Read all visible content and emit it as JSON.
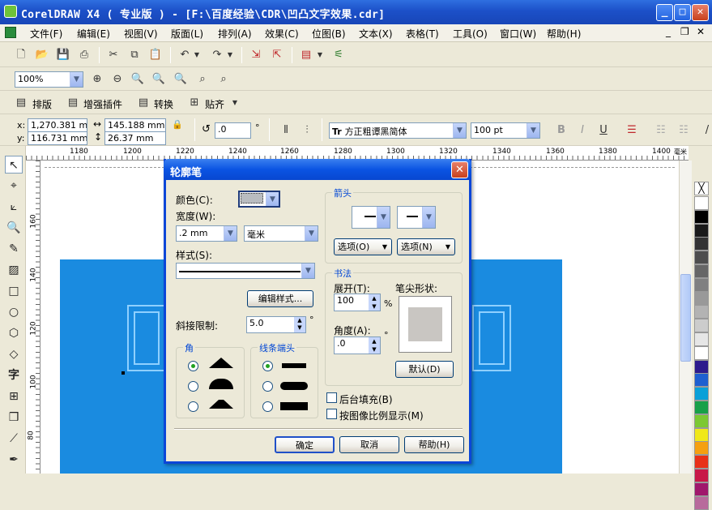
{
  "window": {
    "title": "CorelDRAW X4 ( 专业版 ) - [F:\\百度经验\\CDR\\凹凸文字效果.cdr]"
  },
  "menu": [
    "文件(F)",
    "编辑(E)",
    "视图(V)",
    "版面(L)",
    "排列(A)",
    "效果(C)",
    "位图(B)",
    "文本(X)",
    "表格(T)",
    "工具(O)",
    "窗口(W)",
    "帮助(H)"
  ],
  "zoom": {
    "value": "100%"
  },
  "plugin_bar": {
    "items": [
      "排版",
      "增强插件",
      "转换",
      "贴齐"
    ]
  },
  "property_bar": {
    "x_label": "x:",
    "x_value": "1,270.381 mm",
    "y_label": "y:",
    "y_value": "116.731 mm",
    "width_value": "145.188 mm",
    "height_value": "26.37 mm",
    "angle_value": ".0",
    "angle_unit": "°",
    "font_name": "方正粗谭黑简体",
    "font_size": "100 pt"
  },
  "ruler_h": [
    "1180",
    "1200",
    "1220",
    "1240",
    "1260",
    "1280",
    "1300",
    "1320",
    "1340",
    "1360",
    "1380",
    "1400"
  ],
  "ruler_h_unit": "毫米",
  "ruler_v": [
    "160",
    "140",
    "120",
    "100",
    "80"
  ],
  "palette": [
    "#ffffff",
    "#000000",
    "#1a1a1a",
    "#333333",
    "#4d4d4d",
    "#666666",
    "#808080",
    "#999999",
    "#b3b3b3",
    "#cccccc",
    "#e6e6e6",
    "#ffffff",
    "#2d1a8c",
    "#1e5fd0",
    "#0aa0d8",
    "#18a048",
    "#7cc832",
    "#f0e818",
    "#f5a010",
    "#e83018",
    "#c81848",
    "#a0186c",
    "#b86a9c"
  ],
  "dialog": {
    "title": "轮廓笔",
    "color_label": "颜色(C):",
    "width_label": "宽度(W):",
    "width_value": ".2 mm",
    "unit_value": "毫米",
    "style_label": "样式(S):",
    "edit_style_button": "编辑样式...",
    "miter_label": "斜接限制:",
    "miter_value": "5.0",
    "miter_unit": "°",
    "corners_group": "角",
    "linecaps_group": "线条端头",
    "arrows_group": "箭头",
    "options_left": "选项(O)",
    "options_right": "选项(N)",
    "calligraphy_group": "书法",
    "stretch_label": "展开(T):",
    "stretch_value": "100",
    "stretch_unit": "%",
    "nib_label": "笔尖形状:",
    "angle_label": "角度(A):",
    "angle_value": ".0",
    "angle_unit": "°",
    "default_button": "默认(D)",
    "behind_fill": "后台填充(B)",
    "scale_with_image": "按图像比例显示(M)",
    "ok": "确定",
    "cancel": "取消",
    "help": "帮助(H)"
  }
}
